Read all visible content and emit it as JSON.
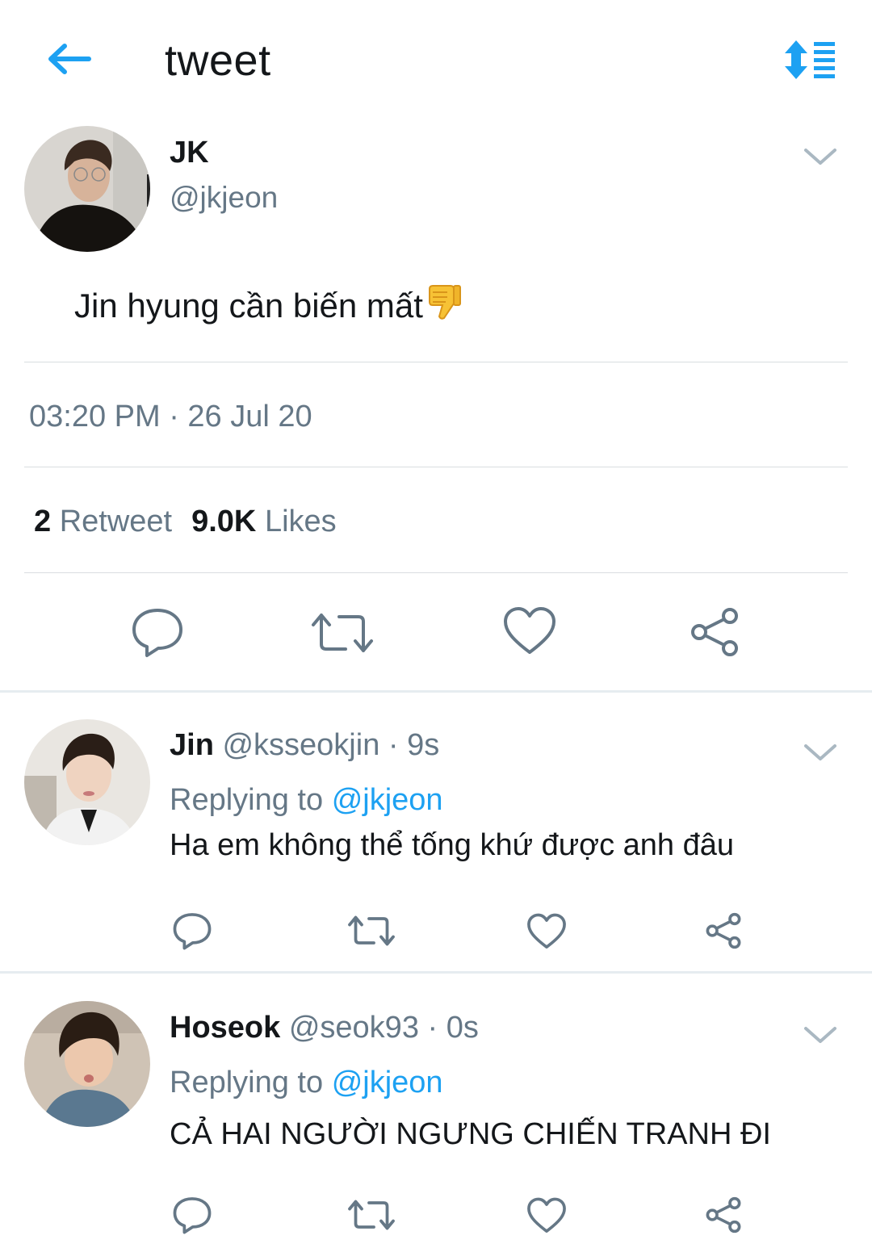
{
  "header": {
    "title": "tweet",
    "back_icon": "arrow-left-icon",
    "sort_icon": "sort-list-icon",
    "accent": "#1da1f2"
  },
  "main_tweet": {
    "name": "JK",
    "handle": "@jkjeon",
    "text": "Jin hyung cần biến mất",
    "emoji": "thumbs-down",
    "time": "03:20 PM · 26 Jul 20",
    "retweet_count": "2",
    "retweet_label": "Retweet",
    "likes_count": "9.0K",
    "likes_label": "Likes"
  },
  "replies": [
    {
      "name": "Jin",
      "handle": "@ksseokjin",
      "age": "· 9s",
      "replying_label": "Replying to",
      "replying_to": "@jkjeon",
      "text": "Ha em không thể tống khứ được anh đâu"
    },
    {
      "name": "Hoseok",
      "handle": "@seok93",
      "age": "· 0s",
      "replying_label": "Replying to",
      "replying_to": "@jkjeon",
      "text": "CẢ HAI NGƯỜI NGƯNG CHIẾN TRANH ĐI"
    }
  ],
  "colors": {
    "text": "#14171a",
    "muted": "#657786",
    "accent": "#1da1f2",
    "divider": "#d9dde0"
  }
}
